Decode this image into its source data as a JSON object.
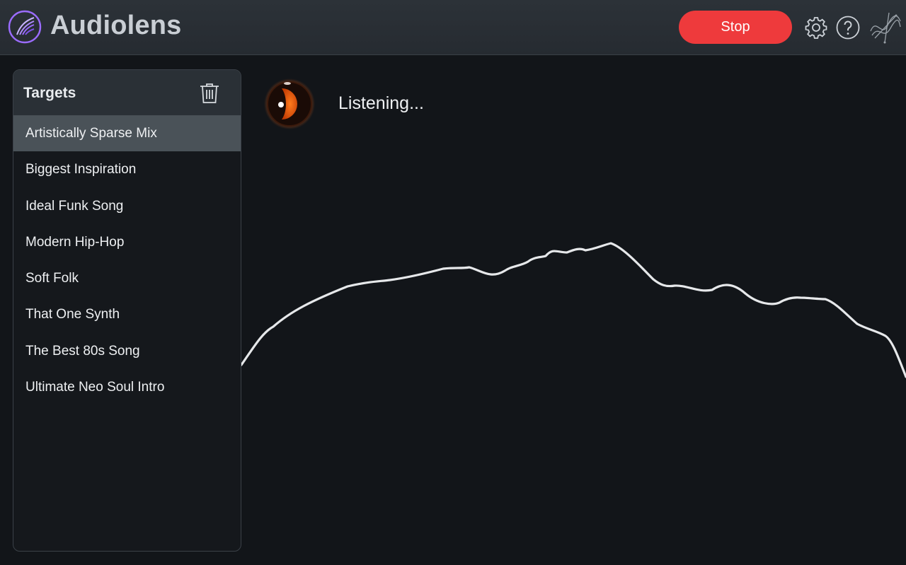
{
  "app": {
    "title": "Audiolens",
    "accent_color": "#ee3a3c",
    "logo_color": "#9b6cff"
  },
  "toolbar": {
    "stop_label": "Stop",
    "icons": [
      "gear-icon",
      "help-icon",
      "brand-logo-icon"
    ]
  },
  "targets": {
    "title": "Targets",
    "delete_icon": "trash-icon",
    "selected_index": 0,
    "items": [
      {
        "label": "Artistically Sparse Mix"
      },
      {
        "label": "Biggest Inspiration"
      },
      {
        "label": "Ideal Funk Song"
      },
      {
        "label": "Modern Hip-Hop"
      },
      {
        "label": "Soft Folk"
      },
      {
        "label": "That One Synth"
      },
      {
        "label": "The Best 80s Song"
      },
      {
        "label": "Ultimate Neo Soul Intro"
      }
    ]
  },
  "status": {
    "text": "Listening...",
    "indicator_color": "#e8550c"
  }
}
